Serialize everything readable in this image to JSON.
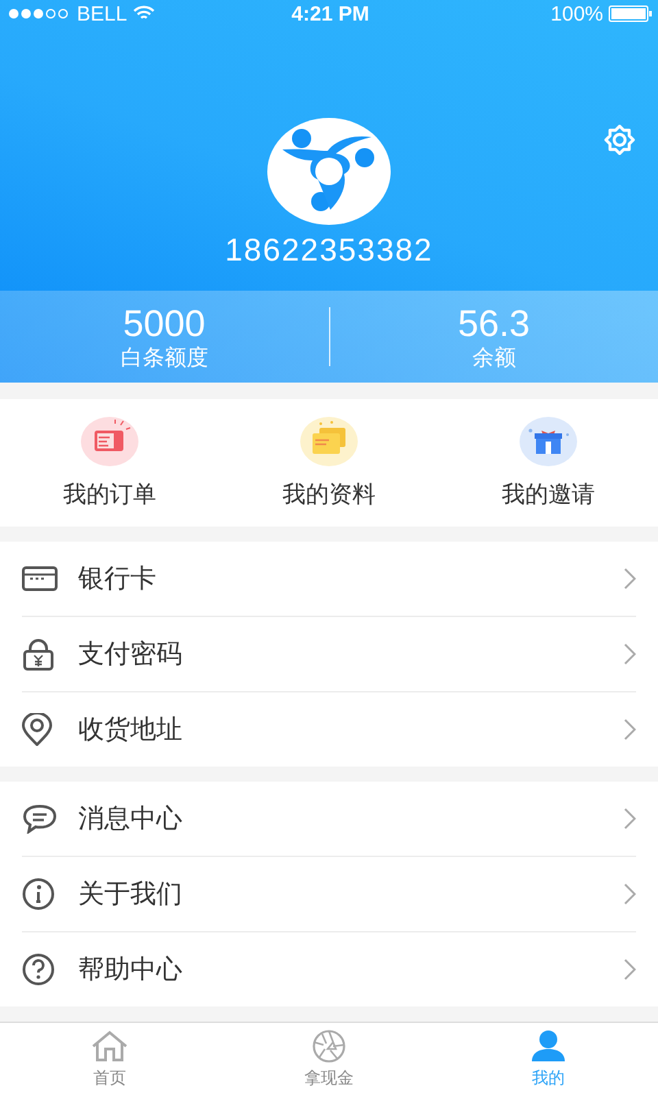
{
  "status_bar": {
    "carrier": "BELL",
    "time": "4:21 PM",
    "battery": "100%"
  },
  "profile": {
    "phone": "18622353382"
  },
  "stats": [
    {
      "value": "5000",
      "label": "白条额度"
    },
    {
      "value": "56.3",
      "label": "余额"
    }
  ],
  "shortcuts": [
    {
      "label": "我的订单"
    },
    {
      "label": "我的资料"
    },
    {
      "label": "我的邀请"
    }
  ],
  "menu_groups": [
    [
      {
        "label": "银行卡"
      },
      {
        "label": "支付密码"
      },
      {
        "label": "收货地址"
      }
    ],
    [
      {
        "label": "消息中心"
      },
      {
        "label": "关于我们"
      },
      {
        "label": "帮助中心"
      }
    ]
  ],
  "tab_bar": [
    {
      "label": "首页",
      "selected": false
    },
    {
      "label": "拿现金",
      "selected": false
    },
    {
      "label": "我的",
      "selected": true
    }
  ]
}
